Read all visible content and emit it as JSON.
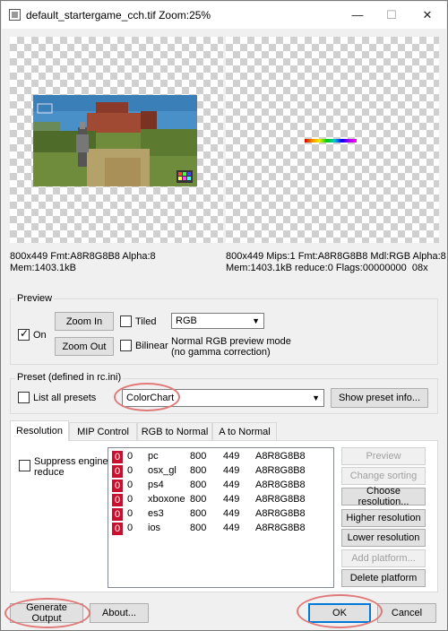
{
  "window": {
    "title": "default_startergame_cch.tif  Zoom:25%",
    "controls": [
      "—",
      "☐",
      "✕"
    ]
  },
  "preview_left": {
    "info_line1": "800x449 Fmt:A8R8G8B8 Alpha:8",
    "info_line2": "Mem:1403.1kB"
  },
  "preview_right": {
    "info_line1": "800x449 Mips:1 Fmt:A8R8G8B8 Mdl:RGB Alpha:8",
    "info_line2": "Mem:1403.1kB reduce:0 Flags:00000000  08x"
  },
  "preview_group": {
    "label": "Preview",
    "on_label": "On",
    "on_checked": true,
    "zoom_in": "Zoom In",
    "zoom_out": "Zoom Out",
    "tiled_label": "Tiled",
    "bilinear_label": "Bilinear",
    "mode_value": "RGB",
    "mode_desc_line1": "Normal RGB preview mode",
    "mode_desc_line2": "(no gamma correction)"
  },
  "preset_group": {
    "label": "Preset (defined in rc.ini)",
    "list_all_label": "List all presets",
    "preset_value": "ColorChart",
    "show_info": "Show preset info..."
  },
  "tabs": [
    "Resolution",
    "MIP Control",
    "RGB to Normal",
    "A to Normal"
  ],
  "resolution": {
    "suppress_label_line1": "Suppress engine",
    "suppress_label_line2": "reduce",
    "rows": [
      {
        "badge": "0",
        "reduce": "0",
        "platform": "pc",
        "width": "800",
        "height": "449",
        "format": "A8R8G8B8"
      },
      {
        "badge": "0",
        "reduce": "0",
        "platform": "osx_gl",
        "width": "800",
        "height": "449",
        "format": "A8R8G8B8"
      },
      {
        "badge": "0",
        "reduce": "0",
        "platform": "ps4",
        "width": "800",
        "height": "449",
        "format": "A8R8G8B8"
      },
      {
        "badge": "0",
        "reduce": "0",
        "platform": "xboxone",
        "width": "800",
        "height": "449",
        "format": "A8R8G8B8"
      },
      {
        "badge": "0",
        "reduce": "0",
        "platform": "es3",
        "width": "800",
        "height": "449",
        "format": "A8R8G8B8"
      },
      {
        "badge": "0",
        "reduce": "0",
        "platform": "ios",
        "width": "800",
        "height": "449",
        "format": "A8R8G8B8"
      }
    ],
    "buttons": {
      "preview": "Preview",
      "change_sorting": "Change sorting",
      "choose_resolution": "Choose resolution...",
      "higher_resolution": "Higher resolution",
      "lower_resolution": "Lower resolution",
      "add_platform": "Add platform...",
      "delete_platform": "Delete platform"
    }
  },
  "footer": {
    "generate_output": "Generate Output",
    "about": "About...",
    "ok": "OK",
    "cancel": "Cancel"
  },
  "colors": {
    "highlight_ring": "#e07a7a",
    "badge_red": "#c8102e",
    "ok_focus": "#0078d7"
  }
}
